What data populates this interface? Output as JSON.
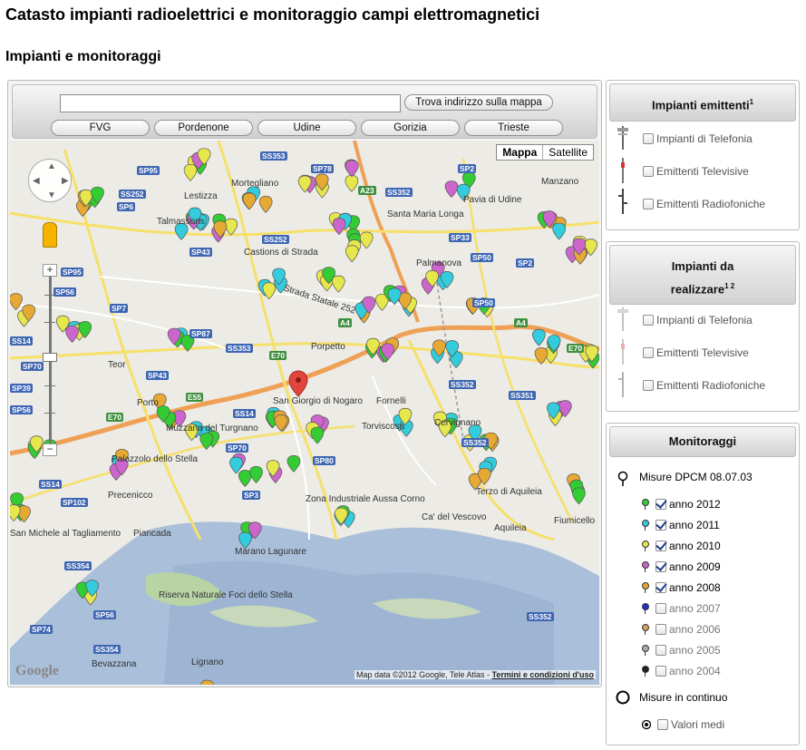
{
  "page": {
    "title": "Catasto impianti radioelettrici e monitoraggio campi elettromagnetici",
    "subtitle": "Impianti e monitoraggi"
  },
  "map": {
    "search_button": "Trova indirizzo sulla mappa",
    "search_value": "",
    "city_buttons": [
      "FVG",
      "Pordenone",
      "Udine",
      "Gorizia",
      "Trieste"
    ],
    "map_types": [
      "Mappa",
      "Satellite"
    ],
    "attribution": "Map data ©2012 Google, Tele Atlas",
    "terms_link": "Termini e condizioni d'uso",
    "google_logo": "Google",
    "road_labels": [
      "SP95",
      "SS252",
      "SS353",
      "SP78",
      "SP2",
      "A23",
      "SS352",
      "SP6",
      "SS252",
      "SP43",
      "SP95",
      "SP56",
      "SP7",
      "SP87",
      "SS353",
      "E70",
      "A4",
      "SP33",
      "SP50",
      "SP2",
      "SP50",
      "E70",
      "A4",
      "SP43",
      "SS14",
      "E55",
      "E70",
      "SP39",
      "SP56",
      "SS14",
      "SP70",
      "SP80",
      "SP3",
      "SS352",
      "SS351",
      "SP102",
      "SS354",
      "SP56",
      "SP74",
      "SS354",
      "SS352",
      "SS352",
      "SS14",
      "SP70"
    ],
    "towns": [
      "Lestizza",
      "Mortegliano",
      "Talmassons",
      "Castions di Strada",
      "Teor",
      "Porpetto",
      "San Giorgio di Nogaro",
      "Fornelli",
      "Torviscosa",
      "Cervignano",
      "Terzo di Aquileia",
      "Aquileia",
      "Ca' del Vescovo",
      "Fiumicello",
      "Palmanova",
      "Santa Maria Longa",
      "Manzano",
      "Pavia di Udine",
      "Piancada",
      "Zona Industriale Aussa Corno",
      "Marano Lagunare",
      "Riserva Naturale Foci dello Stella",
      "Bevazzana",
      "Lignano",
      "Precenicco",
      "Palazzolo dello Stella",
      "Muzzana del Turgnano",
      "Porto",
      "San Michele al Tagliamento"
    ],
    "road_names": [
      "Strada Statale 252"
    ]
  },
  "panels": {
    "emittenti": {
      "title": "Impianti emittenti",
      "sup": "1",
      "items": [
        {
          "label": "Impianti di Telefonia",
          "checked": false,
          "icon": "cell-tower-icon"
        },
        {
          "label": "Emittenti Televisive",
          "checked": false,
          "icon": "tv-tower-icon"
        },
        {
          "label": "Emittenti Radiofoniche",
          "checked": false,
          "icon": "radio-tower-icon"
        }
      ]
    },
    "da_realizzare": {
      "title_line1": "Impianti da",
      "title_line2": "realizzare",
      "sup": "1 2",
      "items": [
        {
          "label": "Impianti di Telefonia",
          "checked": false,
          "icon": "cell-tower-icon"
        },
        {
          "label": "Emittenti Televisive",
          "checked": false,
          "icon": "tv-tower-icon"
        },
        {
          "label": "Emittenti Radiofoniche",
          "checked": false,
          "icon": "radio-tower-icon"
        }
      ]
    },
    "monitoraggi": {
      "title": "Monitoraggi",
      "dpcm_label": "Misure DPCM 08.07.03",
      "years": [
        {
          "label": "anno 2012",
          "checked": true,
          "color": "#33cc33"
        },
        {
          "label": "anno 2011",
          "checked": true,
          "color": "#33ccdd"
        },
        {
          "label": "anno 2010",
          "checked": true,
          "color": "#e6e64d"
        },
        {
          "label": "anno 2009",
          "checked": true,
          "color": "#cc66cc"
        },
        {
          "label": "anno 2008",
          "checked": true,
          "color": "#e6a933"
        },
        {
          "label": "anno 2007",
          "checked": false,
          "color": "#2233cc"
        },
        {
          "label": "anno 2006",
          "checked": false,
          "color": "#d9a066"
        },
        {
          "label": "anno 2005",
          "checked": false,
          "color": "#aaaaaa"
        },
        {
          "label": "anno 2004",
          "checked": false,
          "color": "#222222"
        }
      ],
      "continuo_label": "Misure in continuo",
      "valori_label": "Valori medi",
      "valori_checked": false
    }
  }
}
